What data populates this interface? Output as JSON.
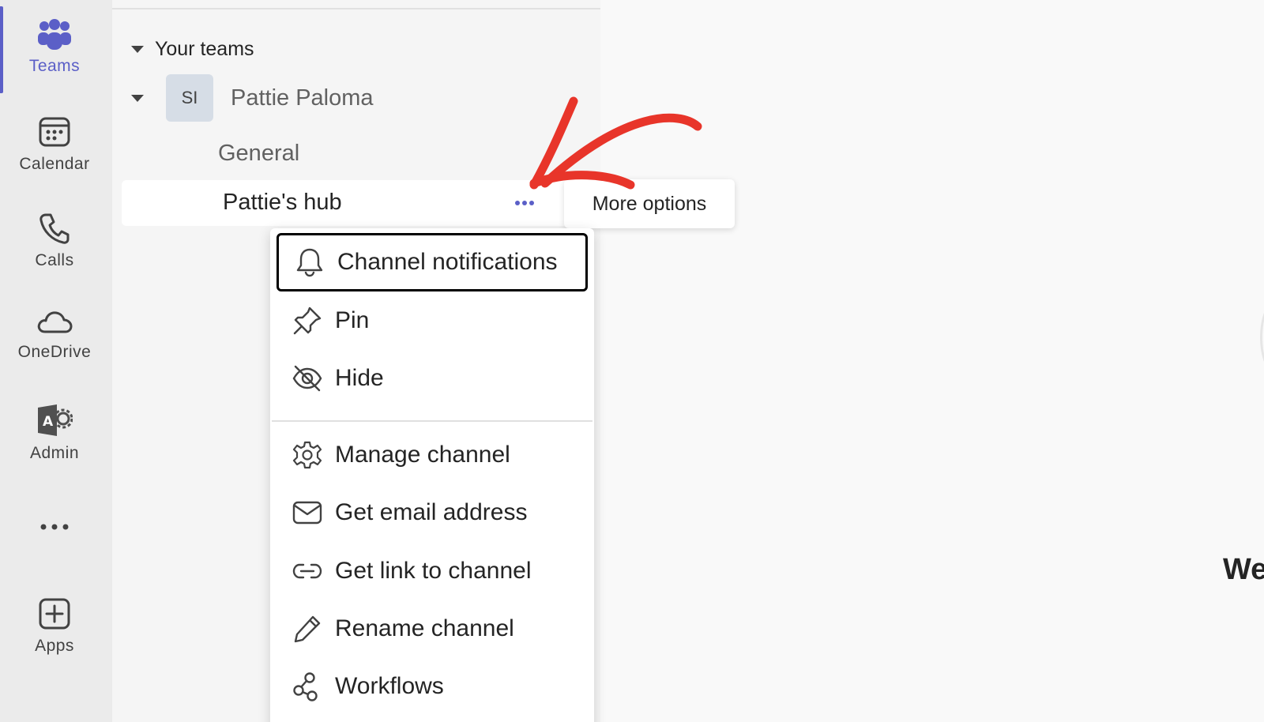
{
  "rail": {
    "items": [
      {
        "label": "Teams",
        "icon": "teams-icon",
        "active": true
      },
      {
        "label": "Calendar",
        "icon": "calendar-icon"
      },
      {
        "label": "Calls",
        "icon": "phone-icon"
      },
      {
        "label": "OneDrive",
        "icon": "cloud-icon"
      },
      {
        "label": "Admin",
        "icon": "admin-icon"
      },
      {
        "label": "",
        "icon": "more-icon"
      },
      {
        "label": "Apps",
        "icon": "add-app-icon"
      }
    ],
    "accent": "#5b5fc7"
  },
  "teams_pane": {
    "section_title": "Your teams",
    "team": {
      "avatar_initials": "SI",
      "name": "Pattie Paloma"
    },
    "channels": [
      {
        "name": "General"
      },
      {
        "name": "Pattie's hub",
        "selected": true
      }
    ]
  },
  "tooltip": {
    "text": "More options"
  },
  "context_menu": {
    "items": [
      {
        "label": "Channel notifications",
        "icon": "bell-icon",
        "focused": true
      },
      {
        "label": "Pin",
        "icon": "pin-icon"
      },
      {
        "label": "Hide",
        "icon": "eye-off-icon"
      },
      {
        "label": "Manage channel",
        "icon": "gear-icon"
      },
      {
        "label": "Get email address",
        "icon": "mail-icon"
      },
      {
        "label": "Get link to channel",
        "icon": "link-icon"
      },
      {
        "label": "Rename channel",
        "icon": "pencil-icon"
      },
      {
        "label": "Workflows",
        "icon": "workflows-icon"
      }
    ]
  },
  "main": {
    "welcome_partial": "We"
  },
  "annotation": {
    "arrow_color": "#e8352a"
  }
}
